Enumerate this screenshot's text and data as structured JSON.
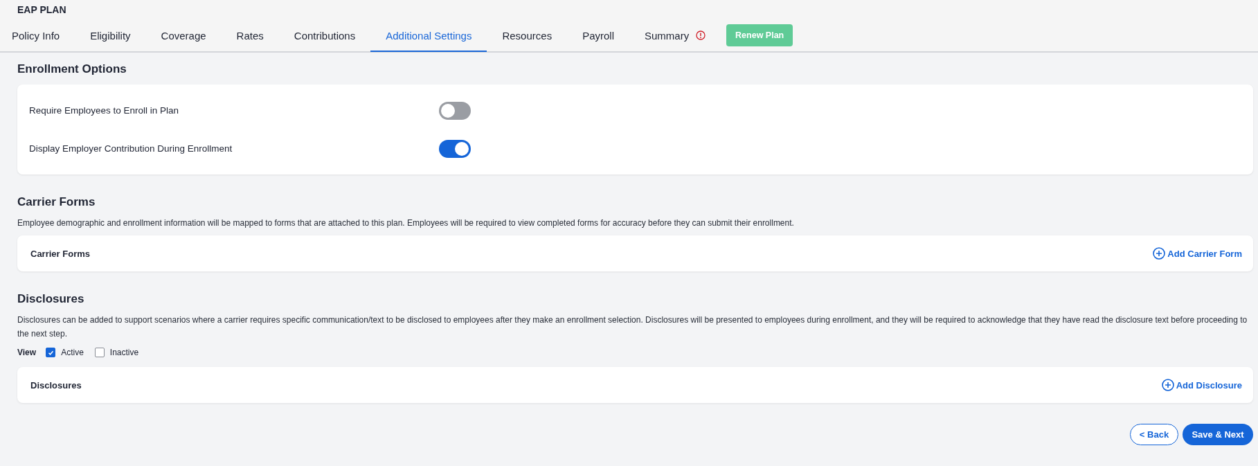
{
  "header": {
    "title": "EAP PLAN"
  },
  "tabs": [
    {
      "label": "Policy Info",
      "selected": false,
      "alert": false
    },
    {
      "label": "Eligibility",
      "selected": false,
      "alert": false
    },
    {
      "label": "Coverage",
      "selected": false,
      "alert": false
    },
    {
      "label": "Rates",
      "selected": false,
      "alert": false
    },
    {
      "label": "Contributions",
      "selected": false,
      "alert": false
    },
    {
      "label": "Additional Settings",
      "selected": true,
      "alert": false
    },
    {
      "label": "Resources",
      "selected": false,
      "alert": false
    },
    {
      "label": "Payroll",
      "selected": false,
      "alert": false
    },
    {
      "label": "Summary",
      "selected": false,
      "alert": true
    }
  ],
  "renew_button": "Renew Plan",
  "enrollment_options": {
    "heading": "Enrollment Options",
    "settings": [
      {
        "label": "Require Employees to Enroll in Plan",
        "on": false
      },
      {
        "label": "Display Employer Contribution During Enrollment",
        "on": true
      }
    ]
  },
  "carrier_forms": {
    "heading": "Carrier Forms",
    "description": "Employee demographic and enrollment information will be mapped to forms that are attached to this plan. Employees will be required to view completed forms for accuracy before they can submit their enrollment.",
    "card_title": "Carrier Forms",
    "add_link": "Add Carrier Form"
  },
  "disclosures": {
    "heading": "Disclosures",
    "description": "Disclosures can be added to support scenarios where a carrier requires specific communication/text to be disclosed to employees after they make an enrollment selection. Disclosures will be presented to employees during enrollment, and they will be required to acknowledge that they have read the disclosure text before proceeding to the next step.",
    "view_label": "View",
    "filters": [
      {
        "label": "Active",
        "checked": true
      },
      {
        "label": "Inactive",
        "checked": false
      }
    ],
    "card_title": "Disclosures",
    "add_link": "Add Disclosure"
  },
  "footer": {
    "back": "< Back",
    "next": "Save & Next"
  }
}
